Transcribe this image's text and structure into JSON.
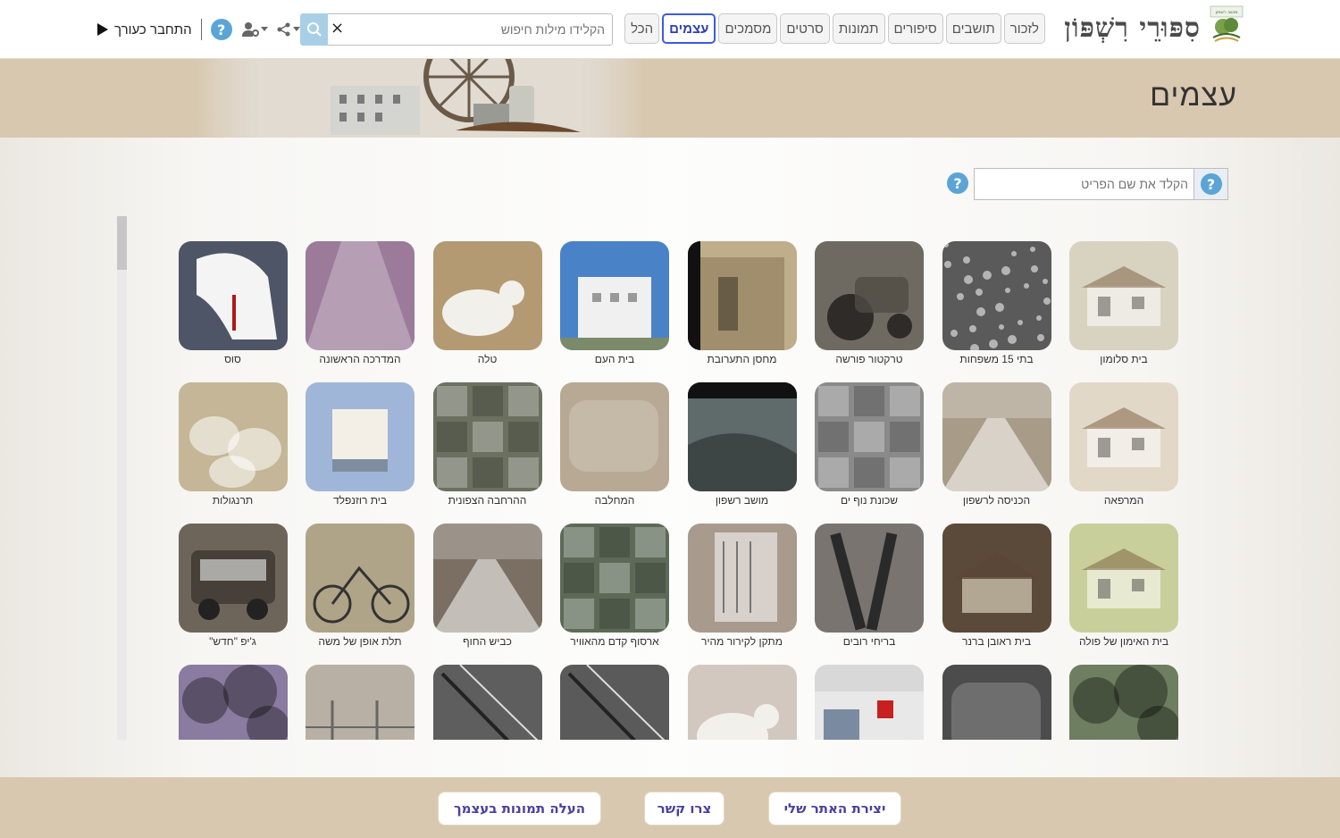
{
  "header": {
    "site_title": "סִפּוּרֵי רִשְׁפּוֹן",
    "logo_caption": "מושב רשפון",
    "tabs": [
      "לזכור",
      "תושבים",
      "סיפורים",
      "תמונות",
      "סרטים",
      "מסמכים",
      "עצמים",
      "הכל"
    ],
    "active_tab": "עצמים",
    "search": {
      "placeholder": "הקלידו מילות חיפוש",
      "value": "",
      "clear_glyph": "×"
    },
    "login_label": "התחבר כעורך",
    "help_glyph": "?"
  },
  "banner": {
    "title": "עצמים"
  },
  "filter": {
    "placeholder": "הקלד את שם הפריט",
    "help_glyph": "?"
  },
  "items": [
    {
      "label": "בית סלומון",
      "tone": "#d8d2c0",
      "hint": "house"
    },
    {
      "label": "בתי 15 משפחות",
      "tone": "#5a5a5a",
      "hint": "aerial-dots"
    },
    {
      "label": "טרקטור פורשה",
      "tone": "#6e6a62",
      "hint": "tractor"
    },
    {
      "label": "מחסן התערובת",
      "tone": "#bfae8a",
      "hint": "building"
    },
    {
      "label": "בית העם",
      "tone": "#4a82c8",
      "hint": "white-building"
    },
    {
      "label": "טלה",
      "tone": "#b49a72",
      "hint": "lamb"
    },
    {
      "label": "המדרכה הראשונה",
      "tone": "#9b7a9a",
      "hint": "path"
    },
    {
      "label": "סוס",
      "tone": "#4e5566",
      "hint": "horse"
    },
    {
      "label": "המרפאה",
      "tone": "#e2d8c8",
      "hint": "house"
    },
    {
      "label": "הכניסה לרשפון",
      "tone": "#a89c88",
      "hint": "road"
    },
    {
      "label": "שכונת נוף ים",
      "tone": "#8a8a8a",
      "hint": "aerial-map"
    },
    {
      "label": "מושב רשפון",
      "tone": "#5f6a6a",
      "hint": "aerial-dark"
    },
    {
      "label": "המחלבה",
      "tone": "#b8a994",
      "hint": "blur"
    },
    {
      "label": "ההרחבה הצפונית",
      "tone": "#6b7060",
      "hint": "aerial-map"
    },
    {
      "label": "בית רוזנפלד",
      "tone": "#9fb6d8",
      "hint": "box"
    },
    {
      "label": "תרנגולות",
      "tone": "#c4b696",
      "hint": "chickens"
    },
    {
      "label": "בית האימון של פולה",
      "tone": "#c9cf9a",
      "hint": "house"
    },
    {
      "label": "בית ראובן ברנר",
      "tone": "#5b4a3a",
      "hint": "roof-house"
    },
    {
      "label": "בריחי רובים",
      "tone": "#7a7470",
      "hint": "tools"
    },
    {
      "label": "מתקן לקירור מהיר",
      "tone": "#a89a8c",
      "hint": "machine"
    },
    {
      "label": "ארסוף קדם מהאוויר",
      "tone": "#5d6a58",
      "hint": "aerial-map"
    },
    {
      "label": "כביש החוף",
      "tone": "#7a6f62",
      "hint": "road"
    },
    {
      "label": "תלת אופן של משה",
      "tone": "#b0a488",
      "hint": "tricycle"
    },
    {
      "label": "ג'יפ \"חדש\"",
      "tone": "#6e655a",
      "hint": "jeep"
    },
    {
      "label": "",
      "tone": "#6e7e60",
      "hint": "trees"
    },
    {
      "label": "",
      "tone": "#4c4c4c",
      "hint": "blur"
    },
    {
      "label": "",
      "tone": "#d8d8d8",
      "hint": "storefront"
    },
    {
      "label": "",
      "tone": "#d2c8c0",
      "hint": "lamb"
    },
    {
      "label": "",
      "tone": "#5a5a5a",
      "hint": "aerial-lines"
    },
    {
      "label": "",
      "tone": "#5e5e5e",
      "hint": "aerial-lines"
    },
    {
      "label": "",
      "tone": "#b8b0a4",
      "hint": "fence"
    },
    {
      "label": "",
      "tone": "#8a7ca0",
      "hint": "trees"
    }
  ],
  "footer": {
    "buttons": [
      "יצירת האתר שלי",
      "צרו קשר",
      "העלה תמונות בעצמך"
    ]
  }
}
